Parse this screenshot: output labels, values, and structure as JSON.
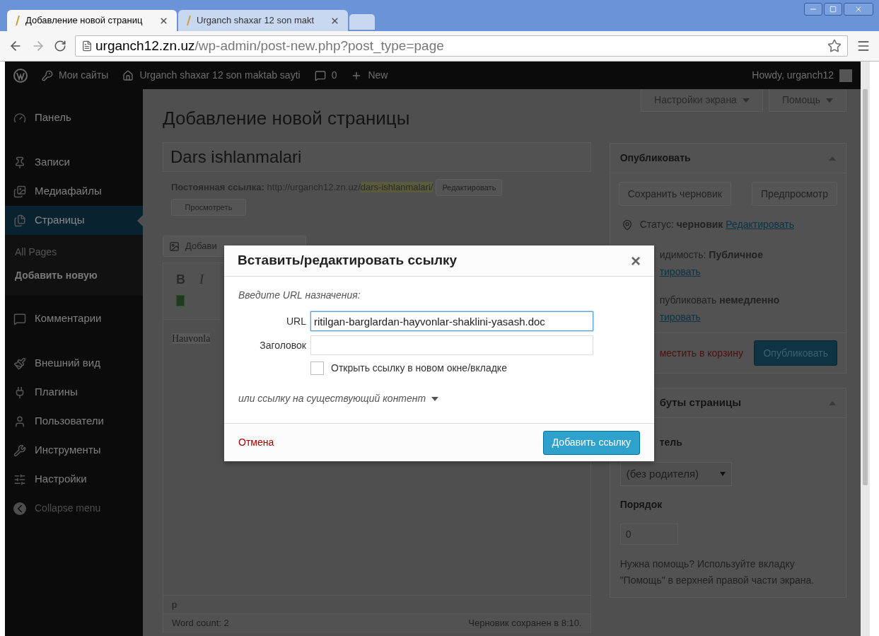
{
  "browser": {
    "tabs": [
      {
        "title": "Добавление новой страниц",
        "selected": true
      },
      {
        "title": "Urganch shaxar 12 son makt",
        "selected": false
      }
    ],
    "address": {
      "host": "urganch12.zn.uz",
      "path": "/wp-admin/post-new.php?post_type=page"
    }
  },
  "admin_bar": {
    "items": [
      "Мои сайты",
      "Urganch shaxar 12 son maktab sayti",
      "0",
      "New"
    ],
    "greeting": "Howdy, urganch12"
  },
  "sidebar": {
    "items": [
      {
        "label": "Панель",
        "selected": false
      },
      {
        "label": "Записи",
        "selected": false
      },
      {
        "label": "Медиафайлы",
        "selected": false
      },
      {
        "label": "Страницы",
        "selected": true,
        "children": [
          {
            "label": "All Pages",
            "selected": false
          },
          {
            "label": "Добавить новую",
            "selected": true
          }
        ]
      },
      {
        "label": "Комментарии",
        "selected": false
      },
      {
        "label": "Внешний вид",
        "selected": false
      },
      {
        "label": "Плагины",
        "selected": false
      },
      {
        "label": "Пользователи",
        "selected": false
      },
      {
        "label": "Инструменты",
        "selected": false
      },
      {
        "label": "Настройки",
        "selected": false
      }
    ],
    "collapse": "Collapse menu"
  },
  "screen_tabs": [
    "Настройки экрана",
    "Помощь"
  ],
  "page_title": "Добавление новой страницы",
  "post_title": "Dars ishlanmalari",
  "permalink": {
    "label": "Постоянная ссылка:",
    "base": "http://urganch12.zn.uz/",
    "slug": "dars-ishlanmalari/",
    "buttons": [
      "Редактировать",
      "Просмотреть"
    ]
  },
  "editor": {
    "media_button": "Добави",
    "toolbar": [
      "B",
      "I"
    ],
    "content": "Hauvonla",
    "path": "p",
    "word_count": "Word count: 2",
    "saved": "Черновик сохранен в 8:10."
  },
  "publish_box": {
    "title": "Опубликовать",
    "buttons": [
      "Сохранить черновик",
      "Предпросмотр"
    ],
    "status": {
      "label": "Статус:",
      "value": "черновик",
      "link": "Редактировать"
    },
    "visibility": {
      "label": "идимость:",
      "value": "Публичное",
      "link": "тировать"
    },
    "schedule": {
      "label": "публиковать",
      "value": "немедленно",
      "link": "тировать"
    },
    "trash": "местить в корзину",
    "publish": "Опубликовать"
  },
  "attributes_box": {
    "title": "буты страницы",
    "parent_label": "тель",
    "parent_value": "(без родителя)",
    "order_label": "Порядок",
    "order_value": "0",
    "help": "Нужна помощь? Используйте вкладку \"Помощь\" в верхней правой части экрана."
  },
  "dialog": {
    "title": "Вставить/редактировать ссылку",
    "close": "×",
    "hint": "Введите URL назначения:",
    "url_label": "URL",
    "url_value": "ritilgan-barglardan-hayvonlar-shaklini-yasash.doc",
    "title_label": "Заголовок",
    "new_tab": {
      "label": "Открыть ссылку в новом окне/вкладке",
      "checked": false
    },
    "existing": {
      "label": "или ссылку на существующий контент",
      "expanded": false
    },
    "cancel": "Отмена",
    "submit": "Добавить ссылку"
  }
}
